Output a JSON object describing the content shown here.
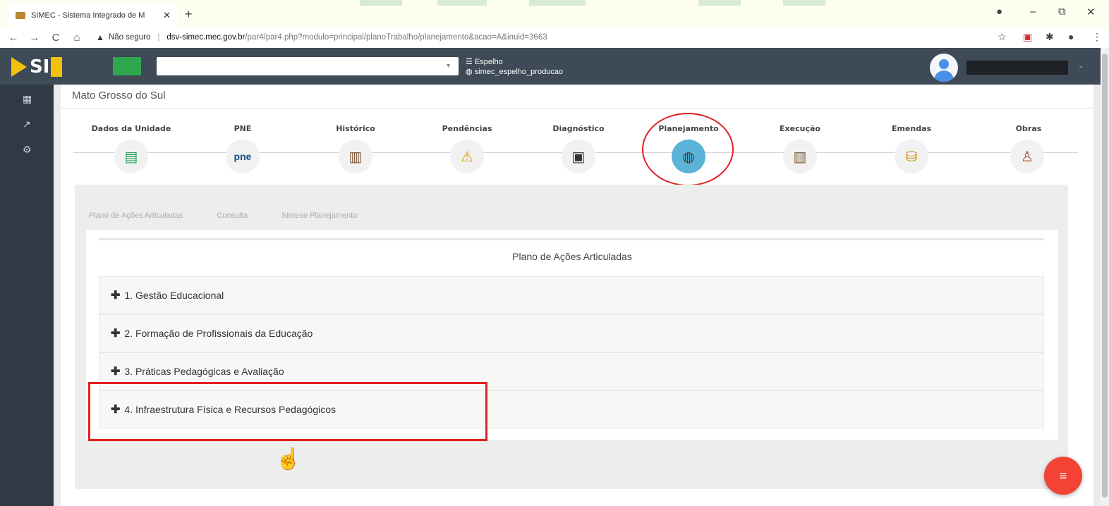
{
  "browser": {
    "tab_title": "SIMEC - Sistema Integrado de M",
    "tab_close": "✕",
    "new_tab": "+",
    "window_controls": {
      "record": "●",
      "minimize": "–",
      "restore": "⧉",
      "close": "✕"
    },
    "nav": {
      "back": "←",
      "forward": "→",
      "reload": "C",
      "home": "⌂"
    },
    "security_warning": "Não seguro",
    "url_host": "dsv-simec.mec.gov.br",
    "url_path": "/par4/par4.php?modulo=principal/planoTrabalho/planejamento&acao=A&inuid=3663",
    "toolbar_icons": [
      "star-icon",
      "pdf-extension-icon",
      "puzzle-extension-icon",
      "profile-icon",
      "kebab-menu-icon"
    ]
  },
  "header": {
    "logo_text": "SI",
    "env_label": "Espelho",
    "env_db": "simec_espelho_producao",
    "select_caret": "▾",
    "user_caret": "⌄"
  },
  "sidebar": {
    "icons": [
      "dashboard-icon",
      "chart-icon",
      "settings-icon"
    ]
  },
  "page": {
    "title": "Mato Grosso do Sul"
  },
  "steps": [
    {
      "label": "Dados da Unidade",
      "icon": "document-icon",
      "glyph": "▤"
    },
    {
      "label": "PNE",
      "icon": "pne-icon",
      "glyph": "pne"
    },
    {
      "label": "Histórico",
      "icon": "history-chart-icon",
      "glyph": "▥"
    },
    {
      "label": "Pendências",
      "icon": "warning-icon",
      "glyph": "⚠"
    },
    {
      "label": "Diagnóstico",
      "icon": "presentation-icon",
      "glyph": "▣"
    },
    {
      "label": "Planejamento",
      "icon": "planning-icon",
      "glyph": "◍"
    },
    {
      "label": "Execução",
      "icon": "execution-chart-icon",
      "glyph": "▥"
    },
    {
      "label": "Emendas",
      "icon": "coins-icon",
      "glyph": "⛁"
    },
    {
      "label": "Obras",
      "icon": "worker-icon",
      "glyph": "♙"
    }
  ],
  "subtabs": [
    "Plano de Ações Articuladas",
    "Consulta",
    "Síntese Planejamento"
  ],
  "section_heading": "Plano de Ações Articuladas",
  "accordion": [
    {
      "label": "1. Gestão Educacional"
    },
    {
      "label": "2. Formação de Profissionais da Educação"
    },
    {
      "label": "3. Práticas Pedagógicas e Avaliação"
    },
    {
      "label": "4. Infraestrutura Física e Recursos Pedagógicos"
    }
  ],
  "accordion_plus": "✚",
  "fab_glyph": "≡",
  "cursor_glyph": "☝",
  "colors": {
    "header_bg": "#3e4a55",
    "sidebar_bg": "#2f3a45",
    "highlight": "#e02020",
    "active_step": "#5bb4d8",
    "fab": "#f44336"
  }
}
